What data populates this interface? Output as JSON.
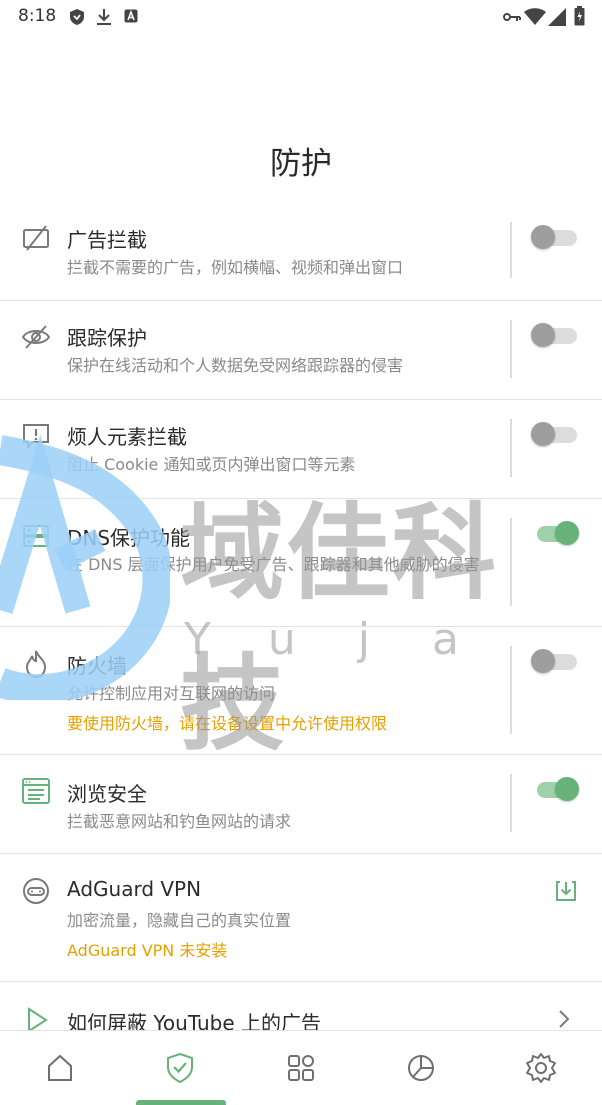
{
  "status_bar": {
    "time": "8:18"
  },
  "page": {
    "title": "防护"
  },
  "items": [
    {
      "title": "广告拦截",
      "description": "拦截不需要的广告，例如横幅、视频和弹出窗口",
      "toggle": false
    },
    {
      "title": "跟踪保护",
      "description": "保护在线活动和个人数据免受网络跟踪器的侵害",
      "toggle": false
    },
    {
      "title": "烦人元素拦截",
      "description": "阻止 Cookie 通知或页内弹出窗口等元素",
      "toggle": false
    },
    {
      "title": "DNS保护功能",
      "description": "在 DNS 层面保护用户免受广告、跟踪器和其他威胁的侵害",
      "toggle": true
    },
    {
      "title": "防火墙",
      "description": "允许控制应用对互联网的访问",
      "warning": "要使用防火墙，请在设备设置中允许使用权限",
      "toggle": false
    },
    {
      "title": "浏览安全",
      "description": "拦截恶意网站和钓鱼网站的请求",
      "toggle": true
    },
    {
      "title": "AdGuard VPN",
      "description": "加密流量，隐藏自己的真实位置",
      "warning": "AdGuard VPN 未安装"
    },
    {
      "title": "如何屏蔽 YouTube 上的广告"
    }
  ],
  "watermark": {
    "text": "域佳科技",
    "sub": "Yuja"
  },
  "colors": {
    "accent": "#67b279",
    "warning": "#e8a000",
    "watermark_blue": "#7fbff0"
  },
  "nav": [
    "home-icon",
    "protection-shield-icon",
    "apps-grid-icon",
    "statistics-pie-icon",
    "settings-gear-icon"
  ]
}
